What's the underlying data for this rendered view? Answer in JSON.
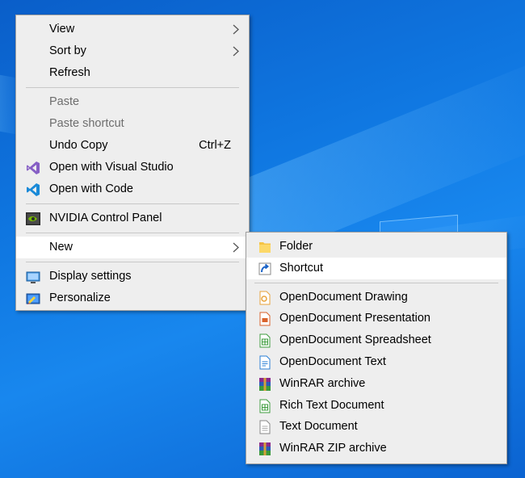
{
  "context_menu": {
    "groups": [
      [
        {
          "label": "View",
          "submenu": true
        },
        {
          "label": "Sort by",
          "submenu": true
        },
        {
          "label": "Refresh"
        }
      ],
      [
        {
          "label": "Paste",
          "disabled": true
        },
        {
          "label": "Paste shortcut",
          "disabled": true
        },
        {
          "label": "Undo Copy",
          "shortcut": "Ctrl+Z"
        },
        {
          "label": "Open with Visual Studio",
          "icon": "visual-studio-icon"
        },
        {
          "label": "Open with Code",
          "icon": "vscode-icon"
        }
      ],
      [
        {
          "label": "NVIDIA Control Panel",
          "icon": "nvidia-icon"
        }
      ],
      [
        {
          "label": "New",
          "submenu": true,
          "highlighted": true
        }
      ],
      [
        {
          "label": "Display settings",
          "icon": "display-icon"
        },
        {
          "label": "Personalize",
          "icon": "personalize-icon"
        }
      ]
    ]
  },
  "new_submenu": {
    "groups": [
      [
        {
          "label": "Folder",
          "icon": "folder-icon"
        },
        {
          "label": "Shortcut",
          "icon": "shortcut-icon",
          "highlighted": true
        }
      ],
      [
        {
          "label": "OpenDocument Drawing",
          "icon": "odg-icon"
        },
        {
          "label": "OpenDocument Presentation",
          "icon": "odp-icon"
        },
        {
          "label": "OpenDocument Spreadsheet",
          "icon": "ods-icon"
        },
        {
          "label": "OpenDocument Text",
          "icon": "odt-icon"
        },
        {
          "label": "WinRAR archive",
          "icon": "winrar-icon"
        },
        {
          "label": "Rich Text Document",
          "icon": "rtf-icon"
        },
        {
          "label": "Text Document",
          "icon": "txt-icon"
        },
        {
          "label": "WinRAR ZIP archive",
          "icon": "winrar-zip-icon"
        }
      ]
    ]
  },
  "colors": {
    "menu_bg": "#eeeeee",
    "highlight_bg": "#ffffff",
    "disabled_text": "#6d6d6d",
    "desktop_blue": "#0f76e0"
  }
}
